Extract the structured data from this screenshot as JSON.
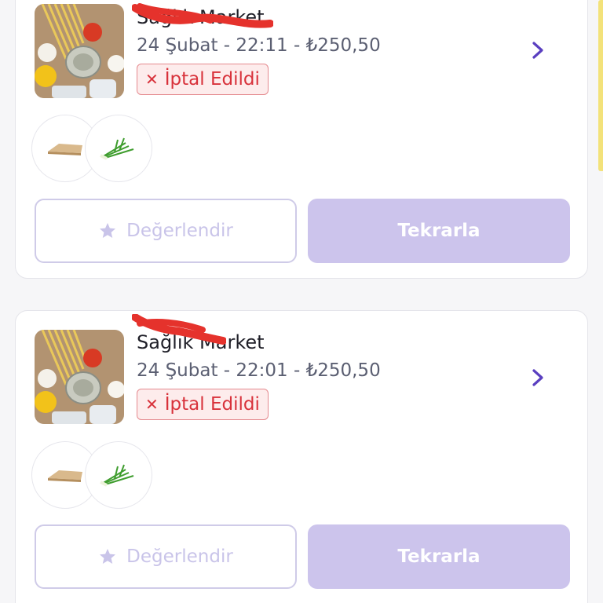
{
  "orders": [
    {
      "store_name": "Sağlık Market",
      "meta": "24 Şubat - 22:11 - ₺250,50",
      "status": "İptal Edildi",
      "status_icon": "close-icon",
      "items": [
        "bread-product",
        "green-onion-product"
      ],
      "rate_label": "Değerlendir",
      "repeat_label": "Tekrarla"
    },
    {
      "store_name": "Sağlık Market",
      "meta": "24 Şubat - 22:01 - ₺250,50",
      "status": "İptal Edildi",
      "status_icon": "close-icon",
      "items": [
        "bread-product",
        "green-onion-product"
      ],
      "rate_label": "Değerlendir",
      "repeat_label": "Tekrarla"
    }
  ],
  "colors": {
    "accent": "#5a3fc0",
    "cancel_red": "#d8323b",
    "repeat_button": "#ccc4ec",
    "rate_border": "#cfcbe8"
  }
}
